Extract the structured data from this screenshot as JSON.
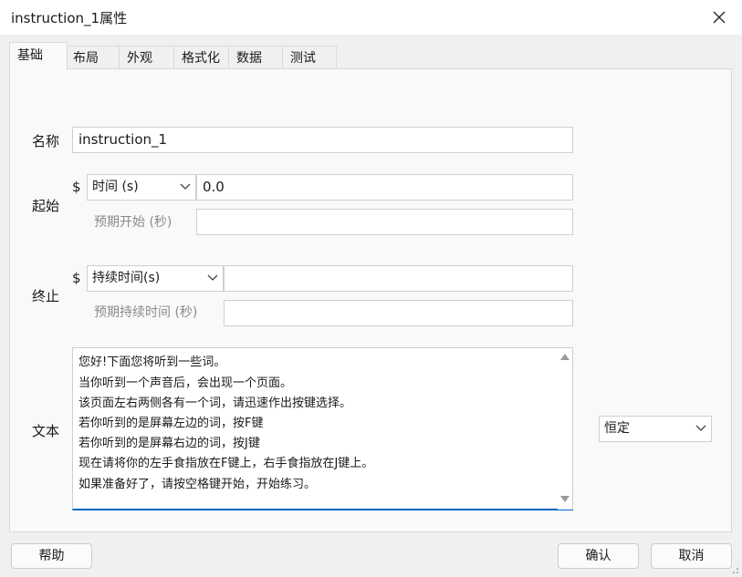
{
  "window": {
    "title": "instruction_1属性"
  },
  "tabs": [
    "基础",
    "布局",
    "外观",
    "格式化",
    "数据",
    "测试"
  ],
  "fields": {
    "name_label": "名称",
    "name_value": "instruction_1",
    "start_label": "起始",
    "start_dollar": "$",
    "start_type": "时间 (s)",
    "start_value": "0.0",
    "start_expected_label": "预期开始 (秒)",
    "start_expected_value": "",
    "stop_label": "终止",
    "stop_dollar": "$",
    "stop_type": "持续时间(s)",
    "stop_value": "",
    "stop_expected_label": "预期持续时间 (秒)",
    "stop_expected_value": "",
    "text_label": "文本",
    "text_lines": [
      "您好!下面您将听到一些词。",
      "当你听到一个声音后，会出现一个页面。",
      "该页面左右两侧各有一个词，请迅速作出按键选择。",
      "若你听到的是屏幕左边的词，按F键",
      "若你听到的是屏幕右边的词，按J键",
      "现在请将你的左手食指放在F键上，右手食指放在J键上。",
      "如果准备好了，请按空格键开始，开始练习。"
    ],
    "text_update": "恒定"
  },
  "buttons": {
    "help": "帮助",
    "ok": "确认",
    "cancel": "取消"
  },
  "colors": {
    "accent": "#0067c0",
    "dialog_bg": "#f0f0f0",
    "panel_bg": "#f9f9f9"
  }
}
